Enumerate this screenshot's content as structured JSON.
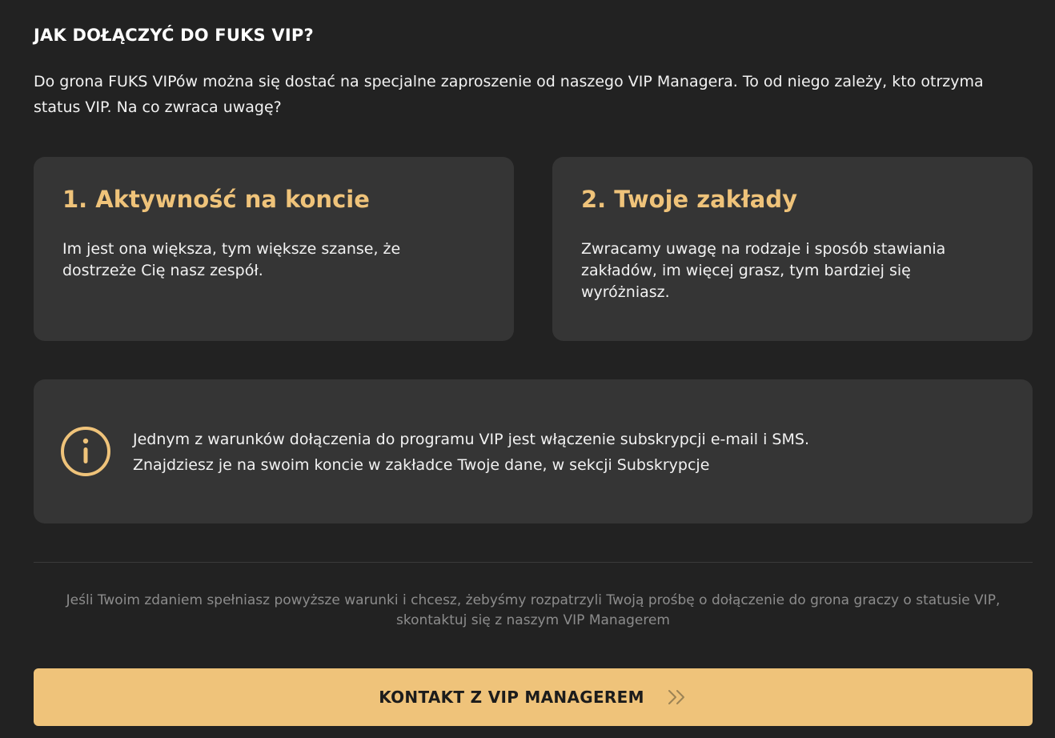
{
  "header": {
    "title": "JAK DOŁĄCZYĆ DO FUKS VIP?",
    "intro": "Do grona FUKS VIPów można się dostać na specjalne zaproszenie od naszego VIP Managera. To od niego zależy, kto otrzyma status VIP. Na co zwraca uwagę?"
  },
  "cards": [
    {
      "title": "1. Aktywność na koncie",
      "text": "Im jest ona większa, tym większe szanse, że dostrzeże Cię nasz zespół."
    },
    {
      "title": "2. Twoje zakłady",
      "text": "Zwracamy uwagę na rodzaje i sposób stawiania zakładów, im więcej grasz, tym bardziej się wyróżniasz."
    }
  ],
  "info": {
    "icon": "info-icon",
    "line1": "Jednym z warunków dołączenia do programu VIP jest włączenie subskrypcji e-mail i SMS.",
    "line2": "Znajdziesz je na swoim koncie w zakładce Twoje dane, w sekcji Subskrypcje"
  },
  "note": "Jeśli Twoim zdaniem spełniasz powyższe warunki i chcesz, żebyśmy rozpatrzyli Twoją prośbę o dołączenie do grona graczy o statusie VIP, skontaktuj się z naszym VIP Managerem",
  "cta": {
    "label": "KONTAKT Z VIP MANAGEREM",
    "icon": "double-chevron-right-icon"
  },
  "colors": {
    "background": "#222222",
    "card": "#353535",
    "accent": "#efc37a",
    "muted_text": "#8c8c8c"
  }
}
